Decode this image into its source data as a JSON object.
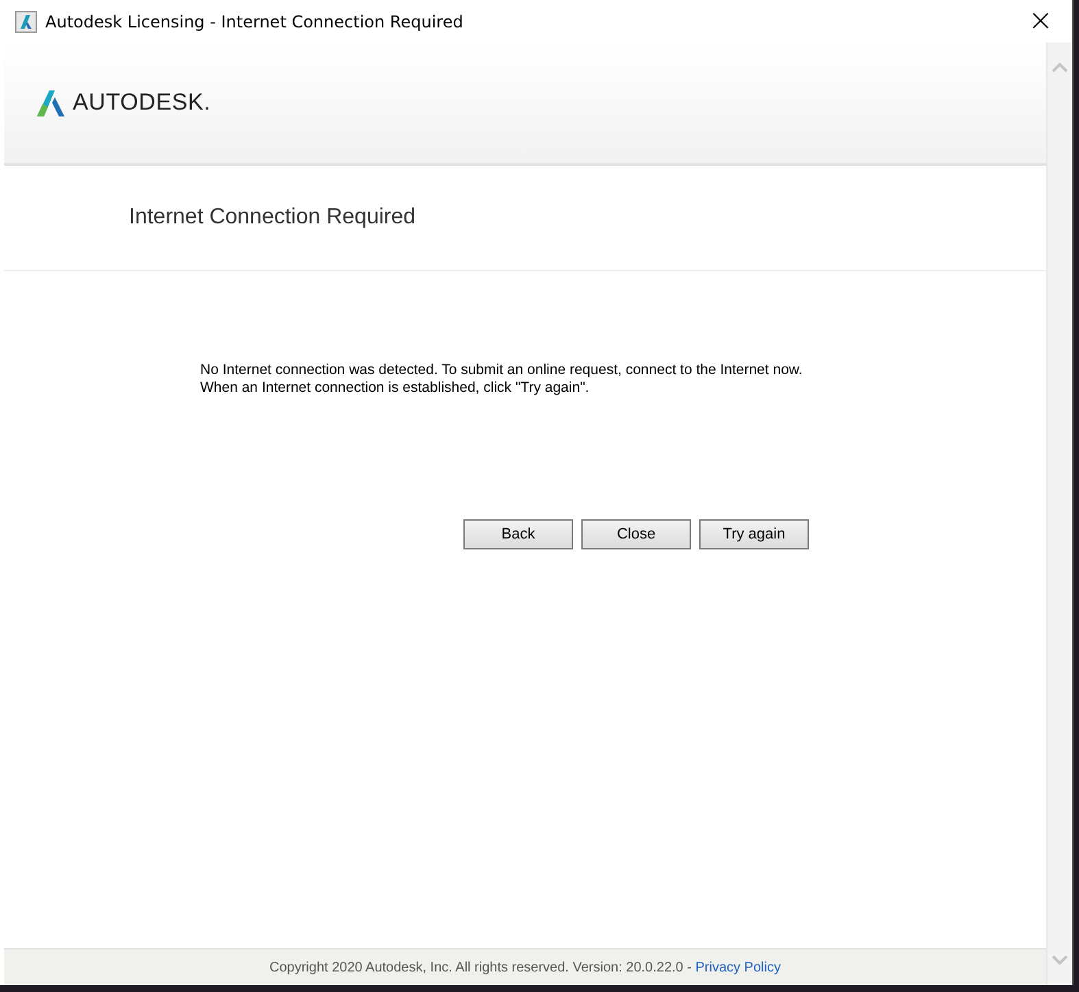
{
  "window": {
    "title": "Autodesk Licensing - Internet Connection Required",
    "close": "×"
  },
  "header": {
    "logo_text": "AUTODESK."
  },
  "page": {
    "heading": "Internet Connection Required",
    "message": [
      "No Internet connection was detected. To submit an online request, connect to the Internet now.",
      "When an Internet connection is established, click \"Try again\"."
    ],
    "buttons": [
      "Back",
      "Close",
      "Try again"
    ]
  },
  "footer": {
    "text": "Copyright 2020 Autodesk, Inc. All rights reserved. Version: 20.0.22.0 - ",
    "link": "Privacy Policy"
  }
}
